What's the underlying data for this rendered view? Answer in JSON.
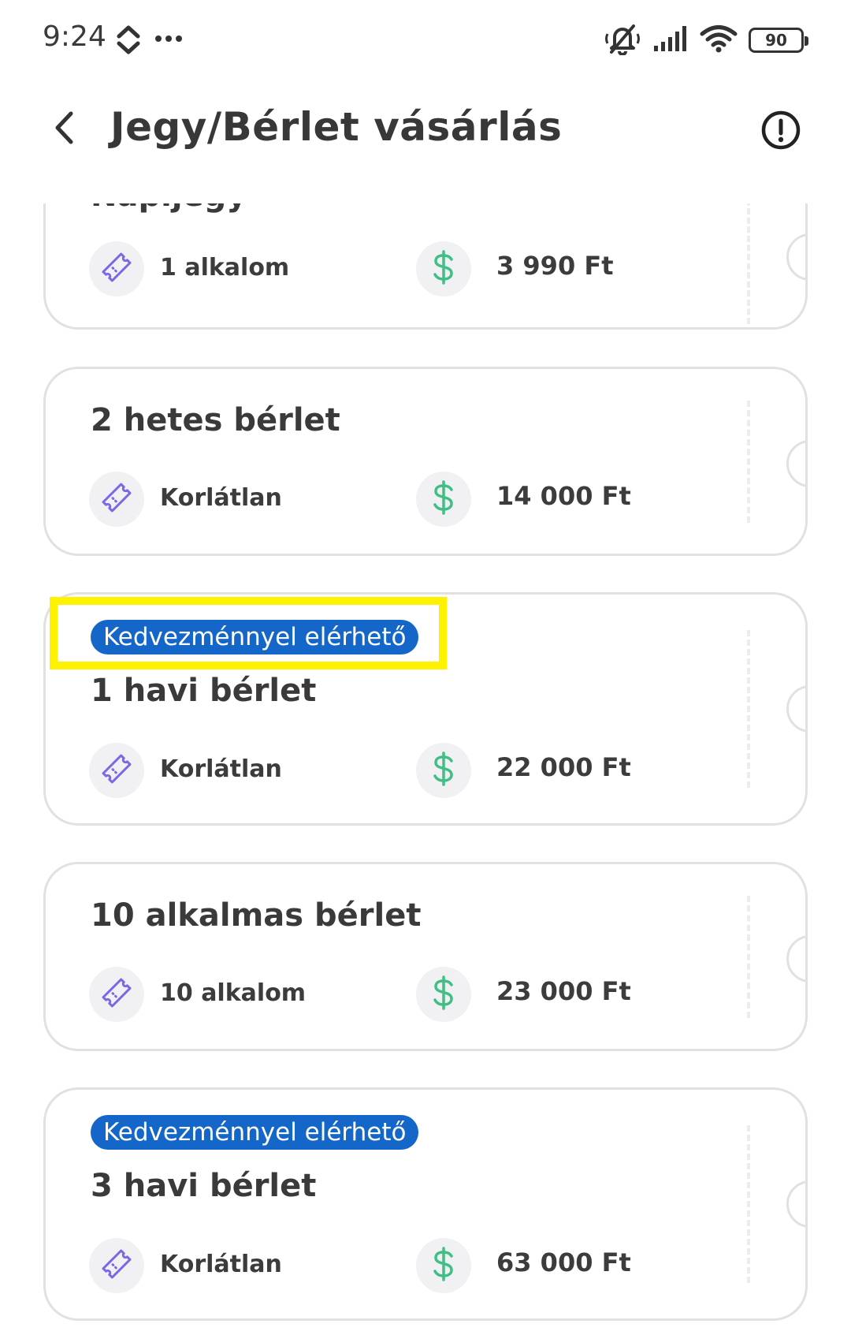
{
  "status_bar": {
    "time": "9:24",
    "battery": "90",
    "icons": [
      "sync-icon",
      "more-dots-icon",
      "mute-icon",
      "signal-icon",
      "wifi-icon",
      "battery-icon"
    ]
  },
  "header": {
    "title": "Jegy/Bérlet vásárlás",
    "back_icon": "chevron-left-icon",
    "info_icon": "alert-circle-icon"
  },
  "tickets": [
    {
      "title": "Napijegy",
      "badge": "",
      "usage": "1 alkalom",
      "price": "3 990 Ft"
    },
    {
      "title": "2 hetes bérlet",
      "badge": "",
      "usage": "Korlátlan",
      "price": "14 000 Ft"
    },
    {
      "title": "1 havi bérlet",
      "badge": "Kedvezménnyel elérhető",
      "usage": "Korlátlan",
      "price": "22 000 Ft"
    },
    {
      "title": "10 alkalmas bérlet",
      "badge": "",
      "usage": "10 alkalom",
      "price": "23 000 Ft"
    },
    {
      "title": "3 havi bérlet",
      "badge": "Kedvezménnyel elérhető",
      "usage": "Korlátlan",
      "price": "63 000 Ft"
    }
  ],
  "colors": {
    "badge_bg": "#1466c8",
    "ticket_icon": "#7b68e6",
    "dollar_icon": "#3fbf86",
    "highlight": "#fff200",
    "card_border": "#e1e1e1"
  }
}
